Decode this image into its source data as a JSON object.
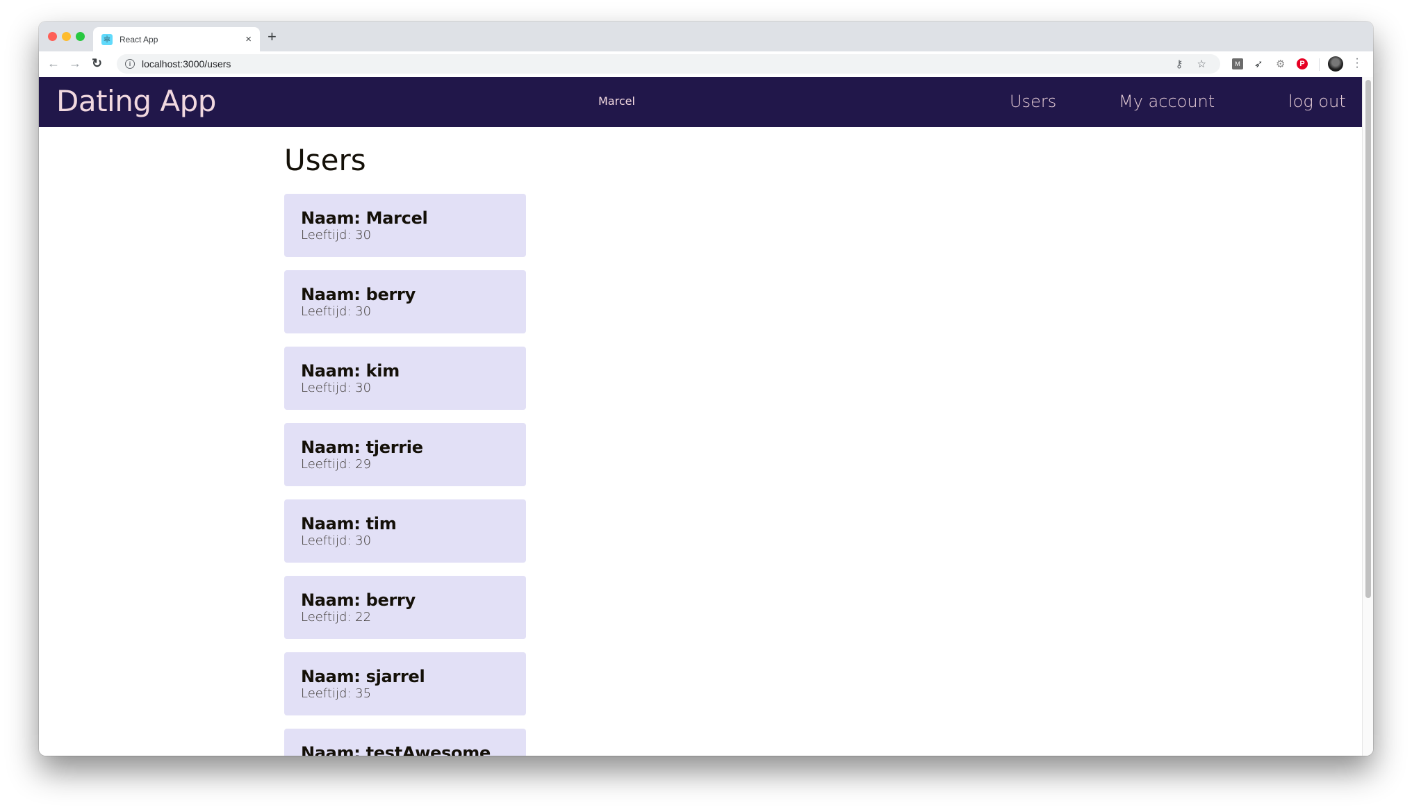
{
  "browser": {
    "tab_title": "React App",
    "tab_favicon": "react-icon",
    "new_tab_label": "+",
    "close_tab_label": "×",
    "url": "localhost:3000/users",
    "icons": {
      "back": "←",
      "forward": "→",
      "reload": "↻",
      "info": "i",
      "key": "⚷",
      "star": "☆",
      "ext_m": "M",
      "rocket": "🚀",
      "gear": "⚙",
      "pinterest": "P",
      "menu": "⋮"
    }
  },
  "app": {
    "brand": "Dating App",
    "current_user": "Marcel",
    "nav": {
      "users": "Users",
      "my_account": "My account",
      "logout": "log out"
    },
    "colors": {
      "header_bg": "#21174a",
      "header_text": "#f1d8df",
      "card_bg": "#e2e0f6"
    }
  },
  "main": {
    "title": "Users",
    "users": [
      {
        "name": "Naam: Marcel",
        "age": "Leeftijd: 30"
      },
      {
        "name": "Naam: berry",
        "age": "Leeftijd: 30"
      },
      {
        "name": "Naam: kim",
        "age": "Leeftijd: 30"
      },
      {
        "name": "Naam: tjerrie",
        "age": "Leeftijd: 29"
      },
      {
        "name": "Naam: tim",
        "age": "Leeftijd: 30"
      },
      {
        "name": "Naam: berry",
        "age": "Leeftijd: 22"
      },
      {
        "name": "Naam: sjarrel",
        "age": "Leeftijd: 35"
      },
      {
        "name": "Naam: testAwesome",
        "age": ""
      }
    ]
  }
}
